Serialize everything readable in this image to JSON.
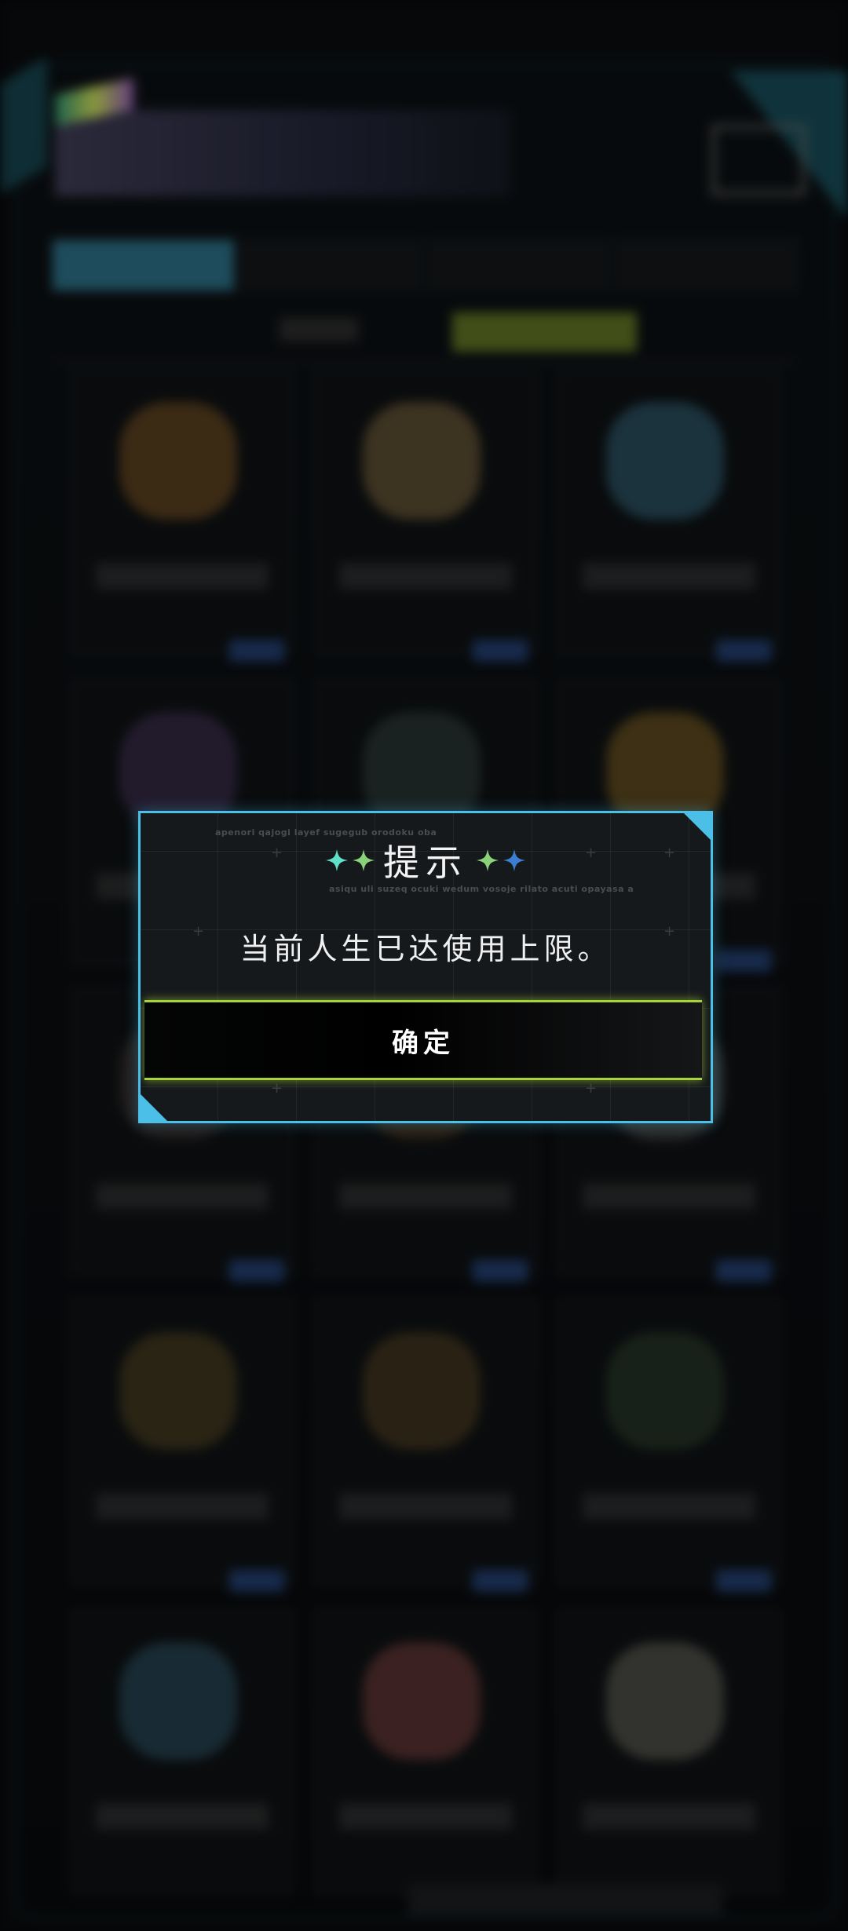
{
  "dialog": {
    "title": "提示",
    "message": "当前人生已达使用上限。",
    "confirm_label": "确定",
    "decor_text_1": "apenori qajogi layef sugegub orodoku oba",
    "decor_text_2": "asiqu uli suzeq ocuki wedum vosoje rilato acuti opayasa a",
    "title_icons": [
      "sparkle-icon-teal",
      "sparkle-icon-green",
      "sparkle-icon-green",
      "sparkle-icon-blue"
    ]
  },
  "colors": {
    "dialog_border": "#4bbfe8",
    "confirm_glow": "#a8d33c",
    "sparkle_teal": "#5fe0c8",
    "sparkle_green": "#8ad27a",
    "sparkle_blue": "#3c7fd0"
  }
}
